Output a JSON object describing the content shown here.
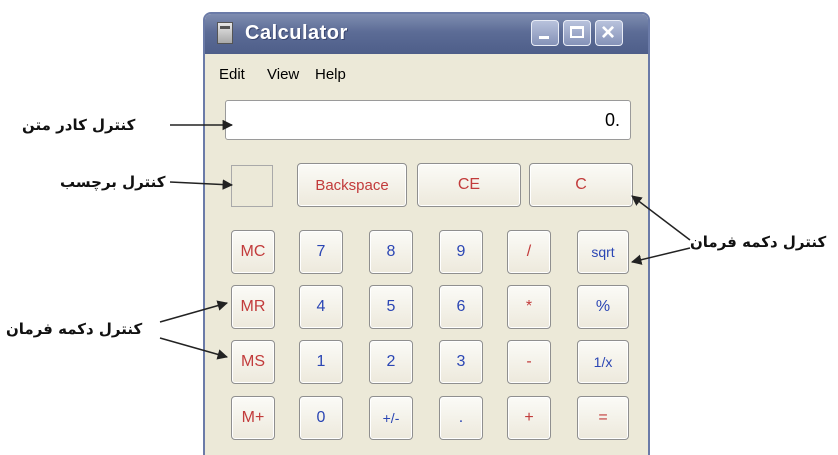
{
  "window": {
    "title": "Calculator",
    "controls": {
      "minimize": "minimize-icon",
      "maximize": "maximize-icon",
      "close": "×"
    }
  },
  "menu": {
    "edit": "Edit",
    "view": "View",
    "help": "Help"
  },
  "display": {
    "value": "0."
  },
  "buttons": {
    "backspace": "Backspace",
    "ce": "CE",
    "c": "C",
    "mc": "MC",
    "mr": "MR",
    "ms": "MS",
    "mplus": "M+",
    "n7": "7",
    "n8": "8",
    "n9": "9",
    "div": "/",
    "sqrt": "sqrt",
    "n4": "4",
    "n5": "5",
    "n6": "6",
    "mul": "*",
    "pct": "%",
    "n1": "1",
    "n2": "2",
    "n3": "3",
    "sub": "-",
    "inv": "1/x",
    "n0": "0",
    "sign": "+/-",
    "dot": ".",
    "add": "+",
    "eq": "="
  },
  "annotations": {
    "textbox": "کنترل کادر متن",
    "label": "کنترل برچسب",
    "command_right": "کنترل دکمه فرمان",
    "command_left": "کنترل دکمه فرمان"
  },
  "colors": {
    "red_key": "#c23b3b",
    "blue_key": "#2b46b4",
    "window_face": "#ece9d8",
    "titlebar": "#5c6c96"
  }
}
